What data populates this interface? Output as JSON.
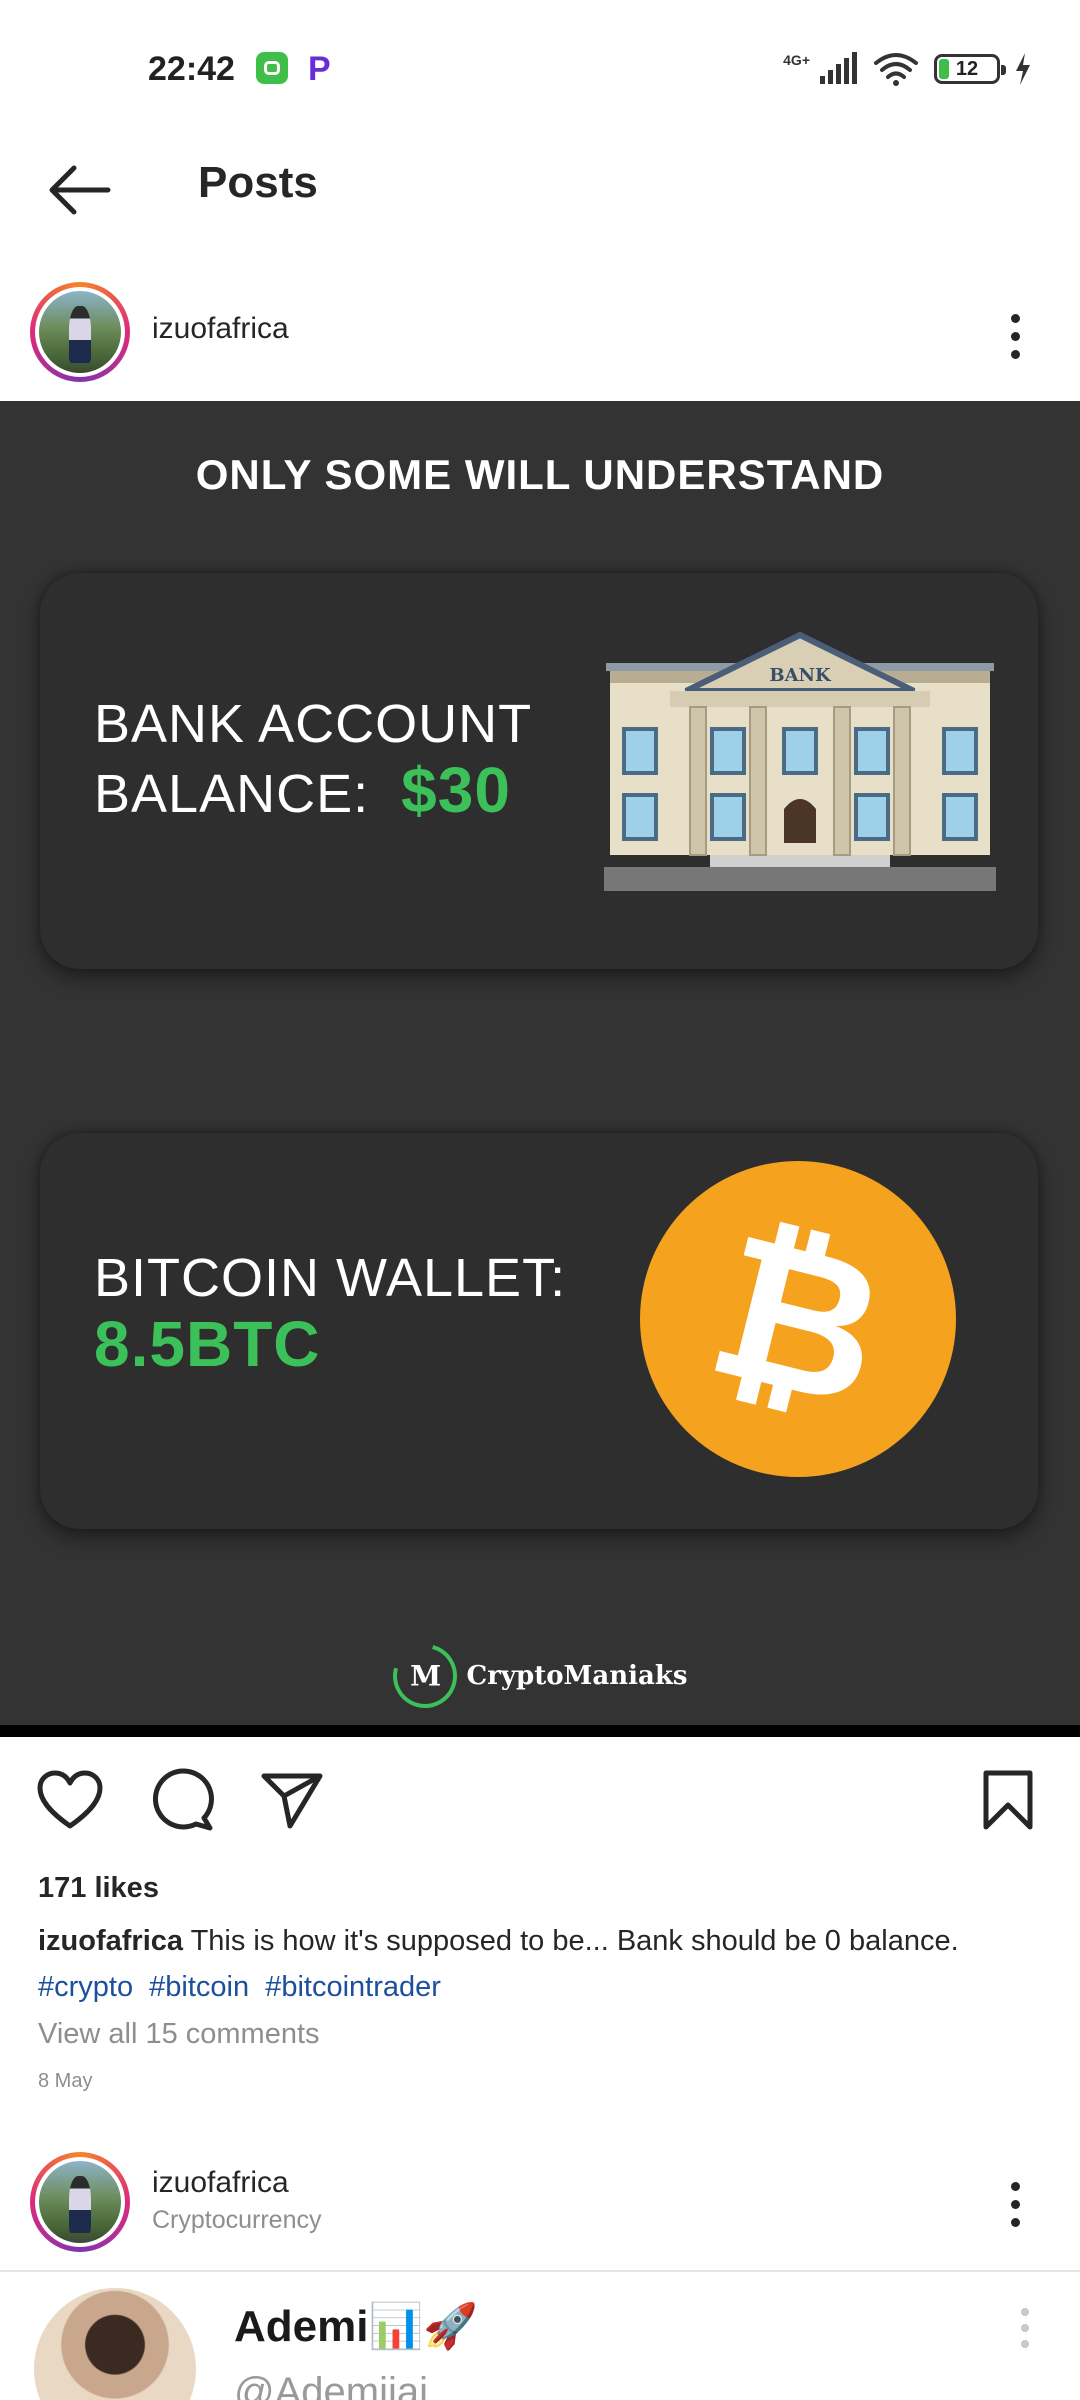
{
  "status_bar": {
    "time": "22:42",
    "network_label": "4G+",
    "battery_level": "12",
    "icons": [
      "app-notification-icon",
      "paypal-icon",
      "signal-icon",
      "wifi-icon",
      "battery-icon",
      "charging-icon"
    ]
  },
  "header": {
    "title": "Posts",
    "back_icon": "arrow-left-icon"
  },
  "post": {
    "username": "izuofafrica",
    "image": {
      "headline": "ONLY SOME WILL UNDERSTAND",
      "bank_line1": "BANK ACCOUNT",
      "bank_line2": "BALANCE:",
      "bank_value": "$30",
      "bank_sign": "BANK",
      "btc_line1": "BITCOIN WALLET:",
      "btc_value": "8.5BTC",
      "btc_symbol": "₿",
      "brand_logo": "M",
      "brand_name": "CryptoManiaks"
    },
    "likes": "171 likes",
    "caption_user": "izuofafrica",
    "caption_text": "This is how it's supposed to be... Bank should be 0 balance.",
    "hashtags": [
      "#crypto",
      "#bitcoin",
      "#bitcointrader"
    ],
    "view_comments": "View all 15 comments",
    "date": "8 May"
  },
  "next_post": {
    "username": "izuofafrica",
    "subtitle": "Cryptocurrency",
    "embed_name": "Ademi",
    "embed_emojis": "📊🚀",
    "embed_handle": "@Ademijai"
  },
  "colors": {
    "accent_green": "#3cc15a",
    "bitcoin_orange": "#f5a21e",
    "image_bg": "#333333",
    "hashtag_blue": "#1c4f9c"
  }
}
